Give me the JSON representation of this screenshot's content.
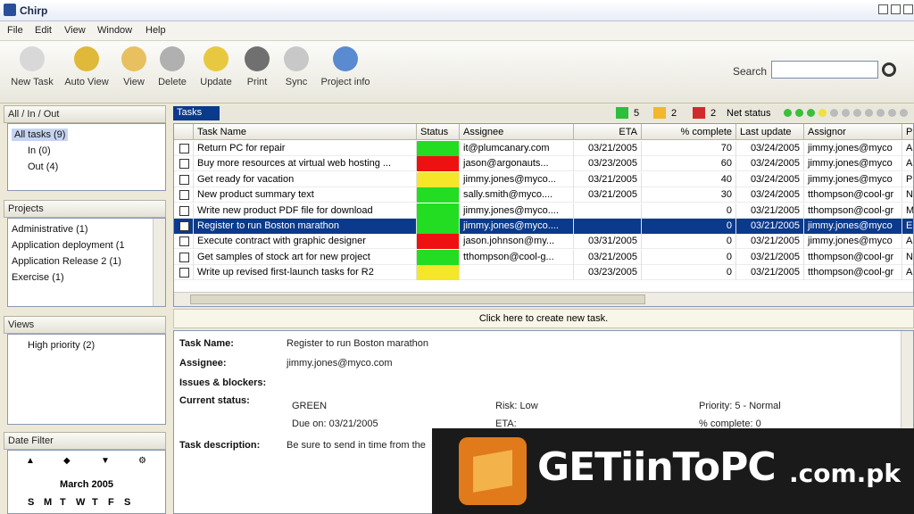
{
  "window": {
    "title": "Chirp"
  },
  "menu": [
    "File",
    "Edit",
    "View",
    "Window",
    "Help"
  ],
  "toolbar": {
    "buttons": [
      {
        "label": "New Task",
        "icon": "new-task-icon",
        "color": "#d8d8d8"
      },
      {
        "label": "Auto View",
        "icon": "auto-view-icon",
        "color": "#e0b83a"
      },
      {
        "label": "View",
        "icon": "view-icon",
        "color": "#e8c060"
      },
      {
        "label": "Delete",
        "icon": "delete-icon",
        "color": "#b0b0b0"
      },
      {
        "label": "Update",
        "icon": "update-icon",
        "color": "#e8c840"
      },
      {
        "label": "Print",
        "icon": "print-icon",
        "color": "#707070"
      },
      {
        "label": "Sync",
        "icon": "sync-icon",
        "color": "#c8c8c8"
      },
      {
        "label": "Project info",
        "icon": "project-info-icon",
        "color": "#5a8ad0"
      }
    ],
    "search_label": "Search"
  },
  "left": {
    "inbox_tab": "All / In / Out",
    "inbox_items": [
      "All tasks (9)",
      "In (0)",
      "Out (4)"
    ],
    "projects_tab": "Projects",
    "projects": [
      "Administrative (1)",
      "Application deployment (1",
      "Application Release 2 (1)",
      "Exercise (1)"
    ],
    "views_tab": "Views",
    "views": [
      "High priority (2)"
    ],
    "datefilter_tab": "Date Filter",
    "calendar_month": "March 2005",
    "calendar_days": [
      "S",
      "M",
      "T",
      "W",
      "T",
      "F",
      "S"
    ]
  },
  "tasks": {
    "tab": "Tasks",
    "counts": [
      {
        "value": "5",
        "color": "#2cbf3a"
      },
      {
        "value": "2",
        "color": "#f2b72a"
      },
      {
        "value": "2",
        "color": "#d12a2a"
      }
    ],
    "net_status_label": "Net status",
    "columns": [
      "Task Name",
      "Status",
      "Assignee",
      "ETA",
      "% complete",
      "Last update",
      "Assignor",
      "P"
    ],
    "rows": [
      {
        "name": "Return  PC for repair",
        "status": "#22dd22",
        "assignee": "it@plumcanary.com",
        "eta": "03/21/2005",
        "pct": "70",
        "updated": "03/24/2005",
        "assignor": "jimmy.jones@myco",
        "p": "A"
      },
      {
        "name": "Buy more resources at virtual web hosting ...",
        "status": "#ee1111",
        "assignee": "jason@argonauts...",
        "eta": "03/23/2005",
        "pct": "60",
        "updated": "03/24/2005",
        "assignor": "jimmy.jones@myco",
        "p": "A"
      },
      {
        "name": "Get ready for vacation",
        "status": "#f5e62a",
        "assignee": "jimmy.jones@myco...",
        "eta": "03/21/2005",
        "pct": "40",
        "updated": "03/24/2005",
        "assignor": "jimmy.jones@myco",
        "p": "P"
      },
      {
        "name": "New product summary text",
        "status": "#22dd22",
        "assignee": "sally.smith@myco....",
        "eta": "03/21/2005",
        "pct": "30",
        "updated": "03/24/2005",
        "assignor": "tthompson@cool-gr",
        "p": "N"
      },
      {
        "name": "Write new product PDF file for download",
        "status": "#22dd22",
        "assignee": "jimmy.jones@myco....",
        "eta": "",
        "pct": "0",
        "updated": "03/21/2005",
        "assignor": "tthompson@cool-gr",
        "p": "M"
      },
      {
        "name": "Register to run Boston marathon",
        "status": "#22dd22",
        "assignee": "jimmy.jones@myco....",
        "eta": "",
        "pct": "0",
        "updated": "03/21/2005",
        "assignor": "jimmy.jones@myco",
        "p": "E",
        "selected": true
      },
      {
        "name": "Execute contract with graphic designer",
        "status": "#ee1111",
        "assignee": "jason.johnson@my...",
        "eta": "03/31/2005",
        "pct": "0",
        "updated": "03/21/2005",
        "assignor": "jimmy.jones@myco",
        "p": "A"
      },
      {
        "name": "Get samples of stock art for new project",
        "status": "#22dd22",
        "assignee": "tthompson@cool-g...",
        "eta": "03/21/2005",
        "pct": "0",
        "updated": "03/21/2005",
        "assignor": "tthompson@cool-gr",
        "p": "N"
      },
      {
        "name": "Write up revised first-launch tasks for R2",
        "status": "#f5e62a",
        "assignee": "",
        "eta": "03/23/2005",
        "pct": "0",
        "updated": "03/21/2005",
        "assignor": "tthompson@cool-gr",
        "p": "A"
      }
    ],
    "create_prompt": "Click here to create new task."
  },
  "detail": {
    "task_name_label": "Task Name:",
    "task_name": "Register to run Boston marathon",
    "assignee_label": "Assignee:",
    "assignee": "jimmy.jones@myco.com",
    "issues_label": "Issues & blockers:",
    "status_label": "Current status:",
    "status": "GREEN",
    "due": "Due on: 03/21/2005",
    "risk": "Risk: Low",
    "eta": "ETA:",
    "priority": "Priority: 5 - Normal",
    "pct": "% complete: 0",
    "desc_label": "Task description:",
    "desc": "Be sure to send in time from the"
  },
  "watermark": {
    "text": "GETiinToPC",
    "suffix": ".com.pk"
  }
}
